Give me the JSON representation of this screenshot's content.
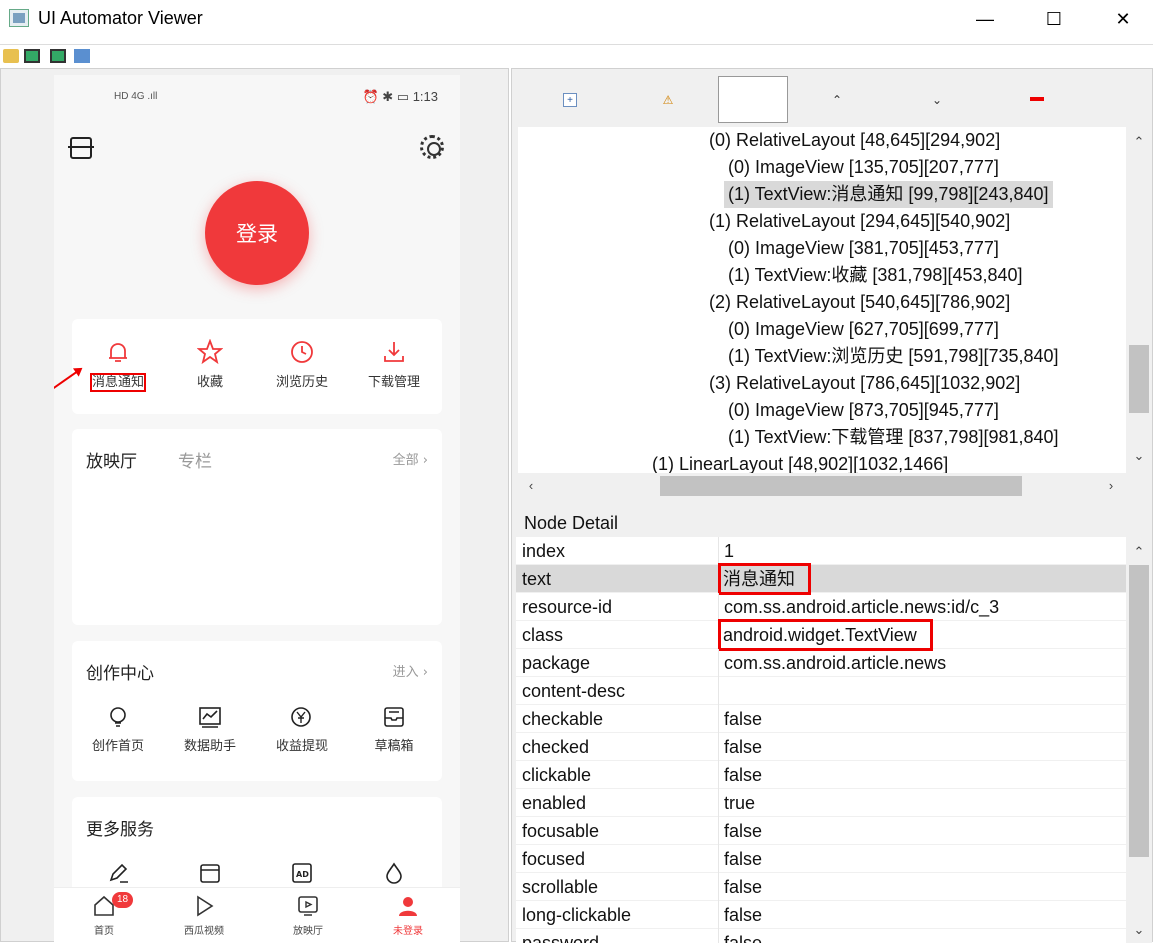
{
  "window": {
    "title": "UI Automator Viewer",
    "minimize": "—",
    "maximize": "☐",
    "close": "✕"
  },
  "phone": {
    "status_left": "HD 4G .ıll",
    "status_time": "1:13",
    "status_right_icons": "⏰ ✱ ▭",
    "login_label": "登录",
    "quick_items": [
      {
        "label": "消息通知",
        "icon": "bell-icon"
      },
      {
        "label": "收藏",
        "icon": "star-icon"
      },
      {
        "label": "浏览历史",
        "icon": "clock-icon"
      },
      {
        "label": "下载管理",
        "icon": "download-icon"
      }
    ],
    "hall": {
      "title": "放映厅",
      "tab2": "专栏",
      "more": "全部 ›"
    },
    "create": {
      "title": "创作中心",
      "more": "进入 ›",
      "items": [
        {
          "label": "创作首页",
          "icon": "bulb-icon"
        },
        {
          "label": "数据助手",
          "icon": "chart-icon"
        },
        {
          "label": "收益提现",
          "icon": "yuan-icon"
        },
        {
          "label": "草稿箱",
          "icon": "drafts-icon"
        }
      ]
    },
    "services": {
      "title": "更多服务",
      "items": [
        {
          "icon": "pen-icon"
        },
        {
          "icon": "wallet-icon"
        },
        {
          "icon": "ad-icon"
        },
        {
          "icon": "drop-icon"
        }
      ]
    },
    "nav": [
      {
        "label": "首页",
        "badge": "18",
        "icon": "home-icon"
      },
      {
        "label": "西瓜视频",
        "icon": "play-icon"
      },
      {
        "label": "放映厅",
        "icon": "tv-icon"
      },
      {
        "label": "未登录",
        "icon": "user-icon",
        "active": true
      }
    ],
    "accent_color": "#f0393b"
  },
  "tree": {
    "nodes": [
      {
        "text": "(0) RelativeLayout [48,645][294,902]",
        "depth": 1
      },
      {
        "text": "(0) ImageView [135,705][207,777]",
        "depth": 2
      },
      {
        "text": "(1) TextView:消息通知 [99,798][243,840]",
        "depth": 2,
        "selected": true
      },
      {
        "text": "(1) RelativeLayout [294,645][540,902]",
        "depth": 1
      },
      {
        "text": "(0) ImageView [381,705][453,777]",
        "depth": 2
      },
      {
        "text": "(1) TextView:收藏 [381,798][453,840]",
        "depth": 2
      },
      {
        "text": "(2) RelativeLayout [540,645][786,902]",
        "depth": 1
      },
      {
        "text": "(0) ImageView [627,705][699,777]",
        "depth": 2
      },
      {
        "text": "(1) TextView:浏览历史 [591,798][735,840]",
        "depth": 2
      },
      {
        "text": "(3) RelativeLayout [786,645][1032,902]",
        "depth": 1
      },
      {
        "text": "(0) ImageView [873,705][945,777]",
        "depth": 2
      },
      {
        "text": "(1) TextView:下载管理 [837,798][981,840]",
        "depth": 2
      },
      {
        "text": "(1) LinearLayout [48,902][1032,1466]",
        "depth": 0
      }
    ]
  },
  "detail": {
    "legend": "Node Detail",
    "rows": [
      {
        "key": "index",
        "value": "1"
      },
      {
        "key": "text",
        "value": "消息通知",
        "selected": true,
        "boxed": true
      },
      {
        "key": "resource-id",
        "value": "com.ss.android.article.news:id/c_3"
      },
      {
        "key": "class",
        "value": "android.widget.TextView",
        "boxed": true
      },
      {
        "key": "package",
        "value": "com.ss.android.article.news"
      },
      {
        "key": "content-desc",
        "value": ""
      },
      {
        "key": "checkable",
        "value": "false"
      },
      {
        "key": "checked",
        "value": "false"
      },
      {
        "key": "clickable",
        "value": "false"
      },
      {
        "key": "enabled",
        "value": "true"
      },
      {
        "key": "focusable",
        "value": "false"
      },
      {
        "key": "focused",
        "value": "false"
      },
      {
        "key": "scrollable",
        "value": "false"
      },
      {
        "key": "long-clickable",
        "value": "false"
      },
      {
        "key": "password",
        "value": "false"
      }
    ]
  }
}
